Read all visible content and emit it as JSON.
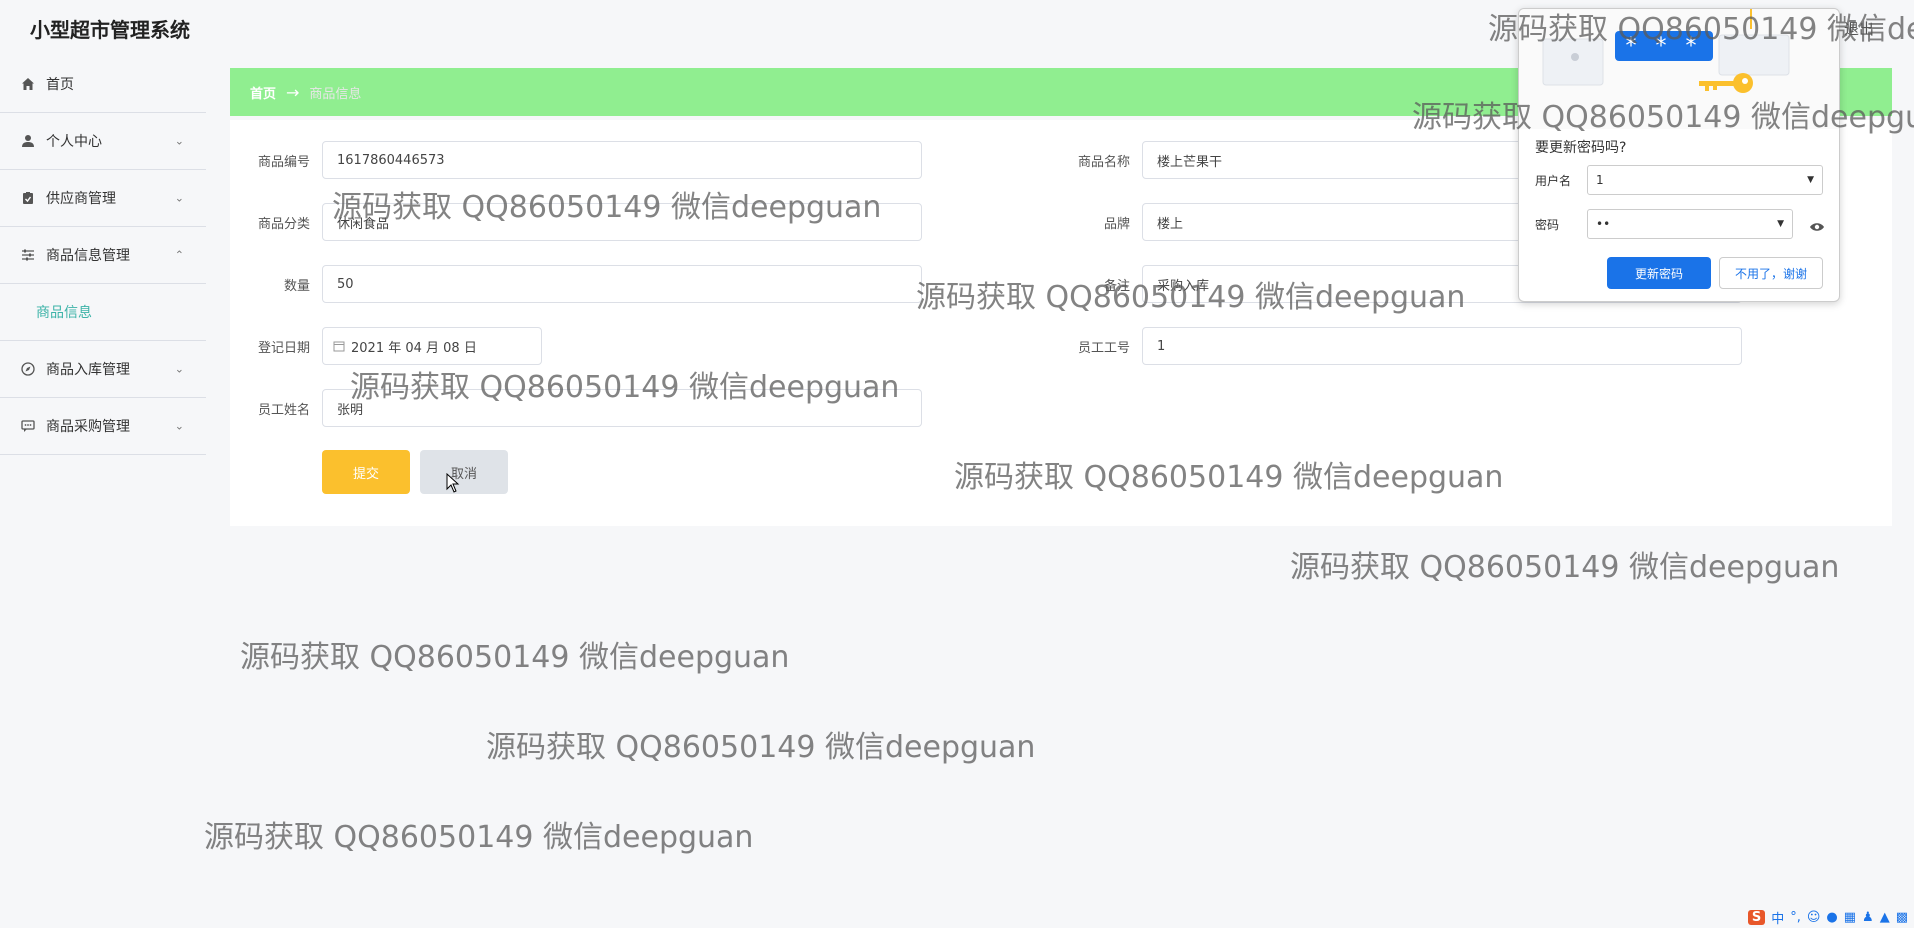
{
  "app": {
    "title": "小型超市管理系统",
    "top_right": "退出"
  },
  "sidebar": {
    "items": [
      {
        "label": "首页",
        "icon": "home-icon"
      },
      {
        "label": "个人中心",
        "icon": "user-icon"
      },
      {
        "label": "供应商管理",
        "icon": "clipboard-icon"
      },
      {
        "label": "商品信息管理",
        "icon": "sliders-icon"
      },
      {
        "label": "商品入库管理",
        "icon": "compass-icon"
      },
      {
        "label": "商品采购管理",
        "icon": "chat-icon"
      }
    ],
    "sub_item": "商品信息"
  },
  "breadcrumb": {
    "home": "首页",
    "current": "商品信息"
  },
  "form": {
    "product_no": {
      "label": "商品编号",
      "value": "1617860446573"
    },
    "product_name": {
      "label": "商品名称",
      "value": "楼上芒果干"
    },
    "category": {
      "label": "商品分类",
      "value": "休闲食品"
    },
    "brand": {
      "label": "品牌",
      "value": "楼上"
    },
    "quantity": {
      "label": "数量",
      "value": "50"
    },
    "remark": {
      "label": "备注",
      "value": "采购入库"
    },
    "reg_date": {
      "label": "登记日期",
      "value": "2021 年 04 月 08 日"
    },
    "employee_no": {
      "label": "员工工号",
      "value": "1"
    },
    "employee_name": {
      "label": "员工姓名",
      "value": "张明"
    },
    "submit": "提交",
    "cancel": "取消"
  },
  "password_popup": {
    "badge": "* * *",
    "title": "要更新密码吗?",
    "username_label": "用户名",
    "username_value": "1",
    "password_label": "密码",
    "password_value": "••",
    "update_button": "更新密码",
    "no_button": "不用了，谢谢"
  },
  "watermark": "源码获取 QQ86050149 微信deepguan",
  "tray": {
    "ime": "中"
  }
}
